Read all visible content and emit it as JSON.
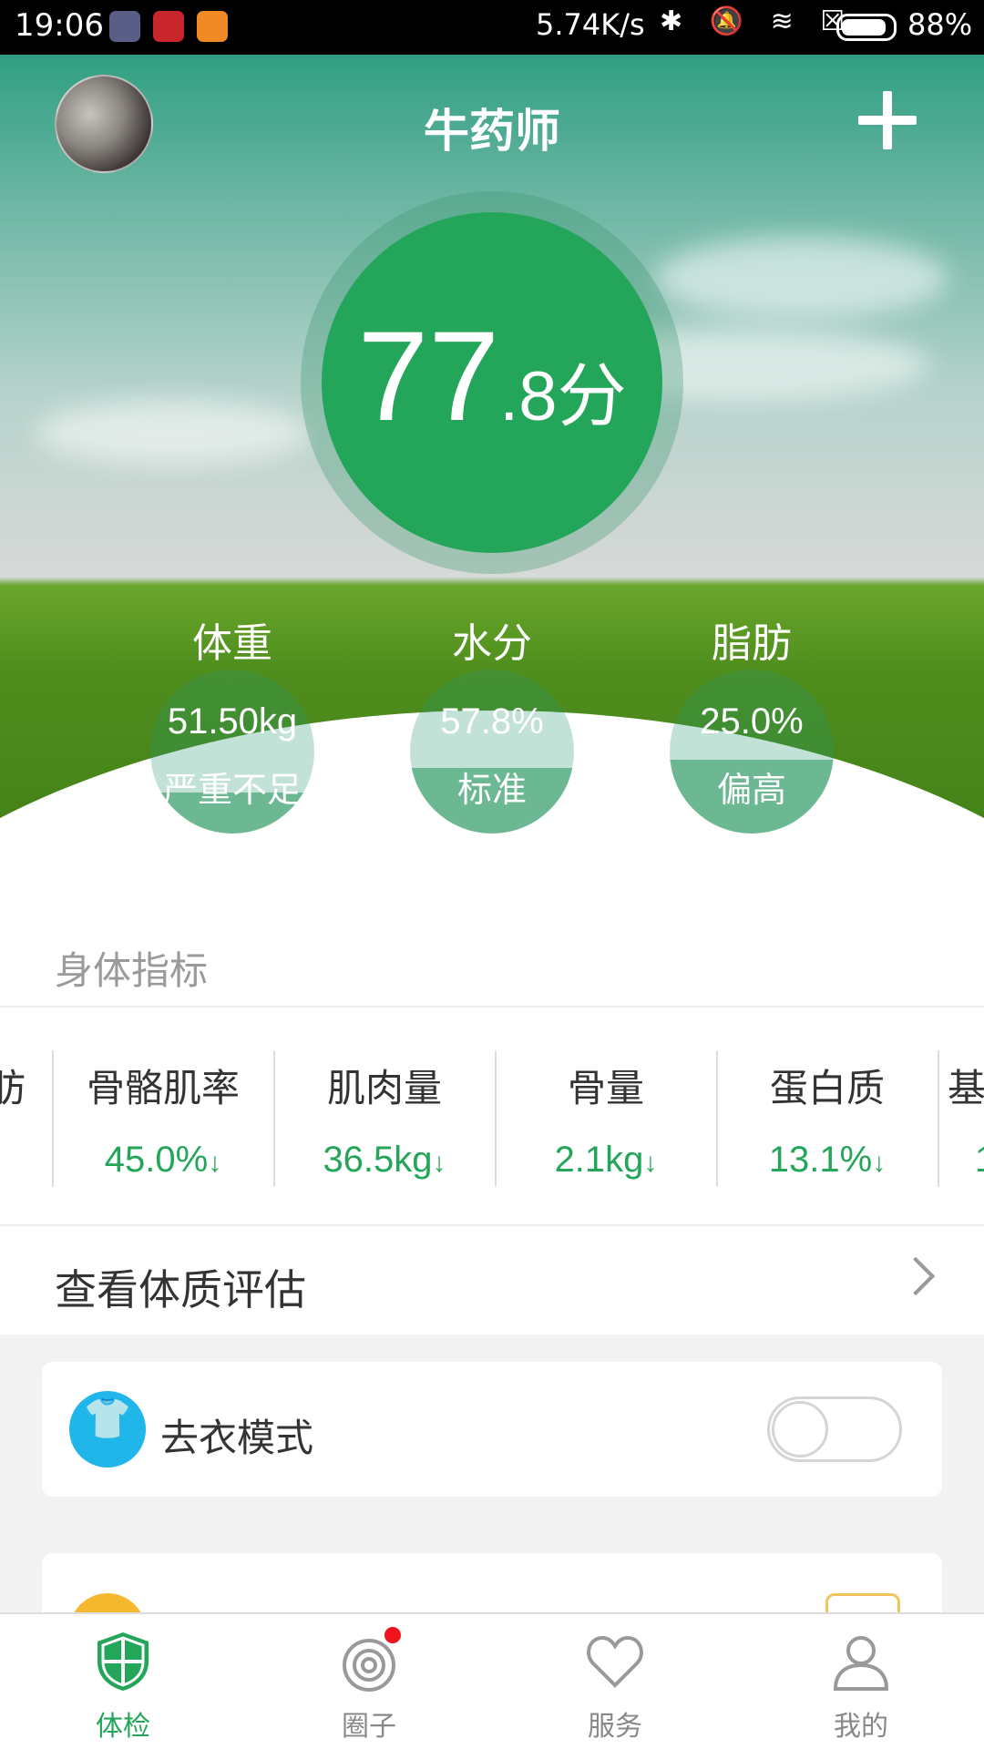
{
  "status_bar": {
    "time": "19:06",
    "speed": "5.74K/s",
    "icons": "✱ 🔕 ≋ ☒",
    "battery": "88%",
    "battery_level": 0.88
  },
  "header": {
    "username": "牛药师",
    "add_icon": "plus-icon"
  },
  "score": {
    "integer": "77",
    "decimal": ".8",
    "unit": "分"
  },
  "metrics": [
    {
      "title": "体重",
      "value": "51.50kg",
      "status": "严重不足",
      "fill": 0.25
    },
    {
      "title": "水分",
      "value": "57.8%",
      "status": "标准",
      "fill": 0.4
    },
    {
      "title": "脂肪",
      "value": "25.0%",
      "status": "偏高",
      "fill": 0.45
    }
  ],
  "indicators": {
    "title": "身体指标",
    "partial_left": "肪",
    "items": [
      {
        "name": "骨骼肌率",
        "value": "45.0%",
        "trend": "down"
      },
      {
        "name": "肌肉量",
        "value": "36.5kg",
        "trend": "down"
      },
      {
        "name": "骨量",
        "value": "2.1kg",
        "trend": "down"
      },
      {
        "name": "蛋白质",
        "value": "13.1%",
        "trend": "down"
      }
    ],
    "partial_right_name": "基",
    "partial_right_value": "1",
    "arrow": "↓"
  },
  "assessment": {
    "label": "查看体质评估"
  },
  "undress_mode": {
    "label": "去衣模式",
    "enabled": false,
    "icon": "tshirt-icon"
  },
  "tabs": [
    {
      "label": "体检",
      "icon": "shield-icon",
      "active": true
    },
    {
      "label": "圈子",
      "icon": "circle-target-icon",
      "active": false,
      "badge": true
    },
    {
      "label": "服务",
      "icon": "heart-icon",
      "active": false
    },
    {
      "label": "我的",
      "icon": "person-icon",
      "active": false
    }
  ],
  "colors": {
    "accent": "#23a65a",
    "toggle_off": "#d5d5d5",
    "shirt_icon_bg": "#21b6ea",
    "badge_red": "#f0141e"
  }
}
